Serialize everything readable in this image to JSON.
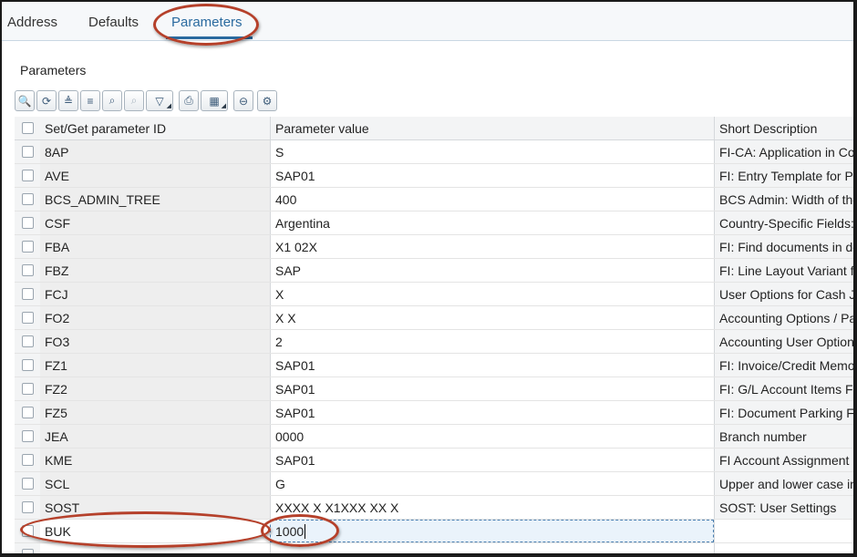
{
  "tabs": [
    {
      "label": "Address"
    },
    {
      "label": "Defaults"
    },
    {
      "label": "Parameters",
      "active": true
    }
  ],
  "section": {
    "title": "Parameters"
  },
  "toolbar": [
    {
      "icon": "zoom-details-icon",
      "glyph": "🔍"
    },
    {
      "icon": "refresh-icon",
      "glyph": "⟳"
    },
    {
      "icon": "sort-ascending-icon",
      "glyph": "≜"
    },
    {
      "icon": "sort-descending-icon",
      "glyph": "≡"
    },
    {
      "icon": "find-icon",
      "glyph": "⌕"
    },
    {
      "icon": "find-next-icon",
      "glyph": "⌕",
      "disabled": true
    },
    {
      "icon": "filter-icon",
      "glyph": "▽",
      "dropdown": true
    },
    {
      "icon": "print-icon",
      "glyph": "⎙"
    },
    {
      "icon": "layout-icon",
      "glyph": "▦",
      "dropdown": true
    },
    {
      "icon": "delete-row-icon",
      "glyph": "⊖"
    },
    {
      "icon": "settings-icon",
      "glyph": "⚙"
    }
  ],
  "columns": {
    "id": "Set/Get parameter ID",
    "value": "Parameter value",
    "desc": "Short Description"
  },
  "rows": [
    {
      "id": "8AP",
      "value": "S",
      "desc": "FI-CA: Application in Co"
    },
    {
      "id": "AVE",
      "value": "SAP01",
      "desc": "FI: Entry Template for Pa"
    },
    {
      "id": "BCS_ADMIN_TREE",
      "value": "400",
      "desc": "BCS Admin: Width of the"
    },
    {
      "id": "CSF",
      "value": "Argentina",
      "desc": "Country-Specific Fields:"
    },
    {
      "id": "FBA",
      "value": "X1 02X",
      "desc": "FI: Find documents in do"
    },
    {
      "id": "FBZ",
      "value": "SAP",
      "desc": "FI: Line Layout Variant f"
    },
    {
      "id": "FCJ",
      "value": "X",
      "desc": "User Options for Cash Jo"
    },
    {
      "id": "FO2",
      "value": "X     X",
      "desc": "Accounting Options / Pa"
    },
    {
      "id": "FO3",
      "value": "2",
      "desc": "Accounting User Options"
    },
    {
      "id": "FZ1",
      "value": "SAP01",
      "desc": "FI: Invoice/Credit Memo"
    },
    {
      "id": "FZ2",
      "value": "SAP01",
      "desc": "FI: G/L Account Items Fa"
    },
    {
      "id": "FZ5",
      "value": "SAP01",
      "desc": "FI: Document Parking Fa"
    },
    {
      "id": "JEA",
      "value": "0000",
      "desc": "Branch number"
    },
    {
      "id": "KME",
      "value": "SAP01",
      "desc": "FI Account Assignment M"
    },
    {
      "id": "SCL",
      "value": "G",
      "desc": "Upper and lower case in"
    },
    {
      "id": "SOST",
      "value": "XXXX    X X1XXX  XX  X",
      "desc": "SOST: User Settings"
    }
  ],
  "new_row": {
    "id": "BUK",
    "value": "1000"
  },
  "colors": {
    "accent": "#2a6a9f",
    "highlight_ellipse": "#b5402a"
  }
}
